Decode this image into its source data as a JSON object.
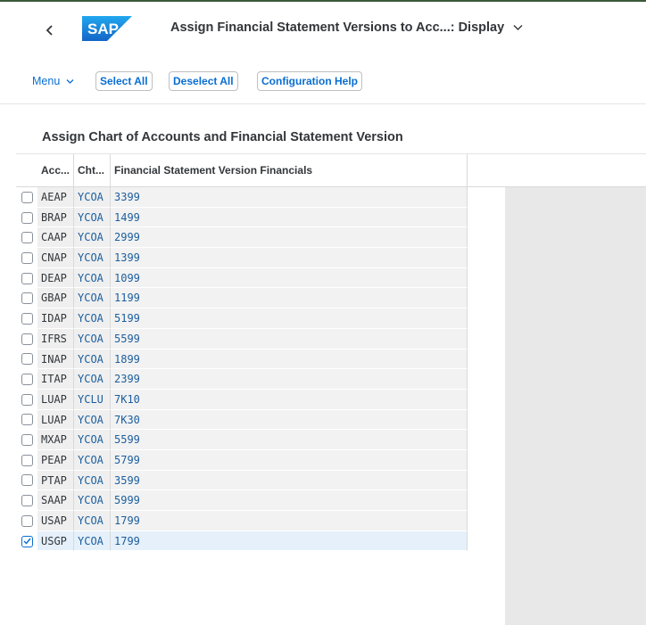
{
  "header": {
    "back_icon": "chevron-left-icon",
    "logo_text": "SAP",
    "title": "Assign Financial Statement Versions to Acc...: Display",
    "title_dropdown_icon": "chevron-down-icon"
  },
  "toolbar": {
    "menu_label": "Menu",
    "select_all": "Select All",
    "deselect_all": "Deselect All",
    "configuration_help": "Configuration Help"
  },
  "section": {
    "title": "Assign Chart of Accounts and Financial Statement Version"
  },
  "table": {
    "columns": [
      "Acc...",
      "Cht...",
      "Financial Statement Version Financials"
    ],
    "rows": [
      {
        "acc": "AEAP",
        "cht": "YCOA",
        "fsv": "3399",
        "selected": false
      },
      {
        "acc": "BRAP",
        "cht": "YCOA",
        "fsv": "1499",
        "selected": false
      },
      {
        "acc": "CAAP",
        "cht": "YCOA",
        "fsv": "2999",
        "selected": false
      },
      {
        "acc": "CNAP",
        "cht": "YCOA",
        "fsv": "1399",
        "selected": false
      },
      {
        "acc": "DEAP",
        "cht": "YCOA",
        "fsv": "1099",
        "selected": false
      },
      {
        "acc": "GBAP",
        "cht": "YCOA",
        "fsv": "1199",
        "selected": false
      },
      {
        "acc": "IDAP",
        "cht": "YCOA",
        "fsv": "5199",
        "selected": false
      },
      {
        "acc": "IFRS",
        "cht": "YCOA",
        "fsv": "5599",
        "selected": false
      },
      {
        "acc": "INAP",
        "cht": "YCOA",
        "fsv": "1899",
        "selected": false
      },
      {
        "acc": "ITAP",
        "cht": "YCOA",
        "fsv": "2399",
        "selected": false
      },
      {
        "acc": "LUAP",
        "cht": "YCLU",
        "fsv": "7K10",
        "selected": false
      },
      {
        "acc": "LUAP",
        "cht": "YCOA",
        "fsv": "7K30",
        "selected": false
      },
      {
        "acc": "MXAP",
        "cht": "YCOA",
        "fsv": "5599",
        "selected": false
      },
      {
        "acc": "PEAP",
        "cht": "YCOA",
        "fsv": "5799",
        "selected": false
      },
      {
        "acc": "PTAP",
        "cht": "YCOA",
        "fsv": "3599",
        "selected": false
      },
      {
        "acc": "SAAP",
        "cht": "YCOA",
        "fsv": "5999",
        "selected": false
      },
      {
        "acc": "USAP",
        "cht": "YCOA",
        "fsv": "1799",
        "selected": false
      },
      {
        "acc": "USGP",
        "cht": "YCOA",
        "fsv": "1799",
        "selected": true
      }
    ]
  },
  "colors": {
    "accent": "#0a6ed1",
    "logo_blue": "#1a7ad4",
    "selected_row": "#e5f0fa"
  }
}
